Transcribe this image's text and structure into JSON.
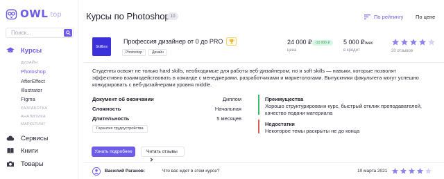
{
  "brand": {
    "name": "OWL",
    "suffix": "top"
  },
  "search": {
    "placeholder": "Поиск..."
  },
  "sidebar": {
    "courses_label": "Курсы",
    "design_head": "ДИЗАЙН",
    "design_items": [
      "Photoshop",
      "AfterEffect",
      "Illustrator",
      "Figma"
    ],
    "active_item": "Photoshop",
    "other_heads": [
      "РАЗРАБОТКА",
      "АНАЛИТИКА",
      "МАРКЕТИНГ"
    ],
    "services_label": "Сервисы",
    "books_label": "Книги",
    "goods_label": "Товары"
  },
  "header": {
    "title": "Курсы по Photoshop",
    "count": "10",
    "sort_rating": "По рейтингу",
    "sort_price": "По цене"
  },
  "course": {
    "school_logo_text": "Skillbox",
    "title": "Профессия дизайнер от 0 до PRO",
    "tags": [
      "Photoshop",
      "Дизайн"
    ],
    "price": "24 000 ₽",
    "discount": "-10 000 ₽",
    "price_caption": "цена",
    "credit": "5 000 ₽",
    "credit_unit": "/мес",
    "credit_caption": "в кредит",
    "rating": 4,
    "rating_max": 5,
    "reviews_count": "20 отзывов",
    "description": "Студенты освоят не только hard skills, необходимые для работы веб-дизайнером, но и soft skills — навыки, которые позволят эффективно взаимодействовать в команде с менеджерами, разработчиками и маркетологами. Выпускники факультета могут успешно конкурировать с веб-дизайнерами уровня middle.",
    "specs": [
      {
        "key": "Документ об окончании",
        "value": "Диплом"
      },
      {
        "key": "Сложность",
        "value": "Начальная"
      },
      {
        "key": "Длительность",
        "value": "5 месяцев"
      }
    ],
    "guarantee": "Гарантия трудоустройства",
    "pros_title": "Преимущества",
    "pros_text": "Хорошо структурированн курс, быстрый отклик преподавателей, качество подачи материала",
    "cons_title": "Недостатки",
    "cons_text": "Некоторое темы раскрыты не до конца",
    "more_button": "Узнать подробнее",
    "reviews_button": "Читать отзывы"
  },
  "review": {
    "author": "Василий Раганов:",
    "text": "Что вас ждет в этом курсе?",
    "date": "10 марта 2021",
    "rating": 4
  },
  "colors": {
    "accent": "#6c5ce7",
    "pros": "#3dbb6a",
    "cons": "#e05a5a",
    "star": "#8e82ee",
    "star_empty": "#d6d2f7",
    "school_logo": "#3b30d9"
  },
  "icons": [
    "owl-logo-icon",
    "search-icon",
    "graduation-cap-icon",
    "cloud-icon",
    "book-icon",
    "camera-icon",
    "sort-icon",
    "trophy-icon",
    "star-icon",
    "chevron-right-icon",
    "user-avatar-icon"
  ]
}
